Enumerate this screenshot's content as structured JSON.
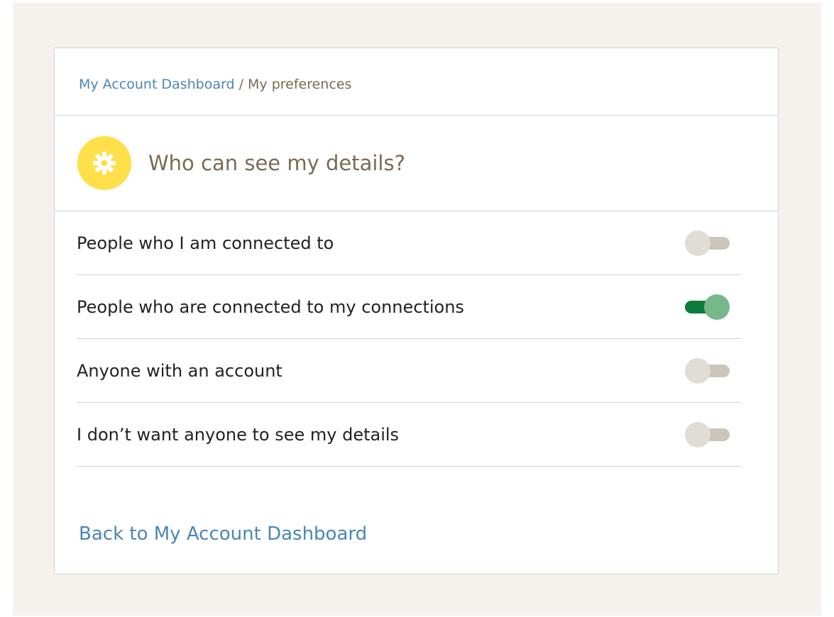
{
  "breadcrumb": {
    "link_label": "My Account Dashboard",
    "separator": "/",
    "current": "My preferences"
  },
  "heading": {
    "icon": "gear-icon",
    "title": "Who can see my details?"
  },
  "options": [
    {
      "label": "People who I am connected to",
      "enabled": false
    },
    {
      "label": "People who are connected to my connections",
      "enabled": true
    },
    {
      "label": "Anyone with an account",
      "enabled": false
    },
    {
      "label": "I don’t want anyone to see my details",
      "enabled": false
    }
  ],
  "back_link": "Back to My Account Dashboard",
  "colors": {
    "page_bg": "#f5f2ee",
    "link": "#4a86b4",
    "heading_text": "#7a6a55",
    "icon_bg": "#ffe04a",
    "toggle_on_track": "#0c7b3c",
    "toggle_on_knob": "#77b88b",
    "toggle_off_track": "#ccc5bc",
    "toggle_off_knob": "#e0dcd7"
  }
}
